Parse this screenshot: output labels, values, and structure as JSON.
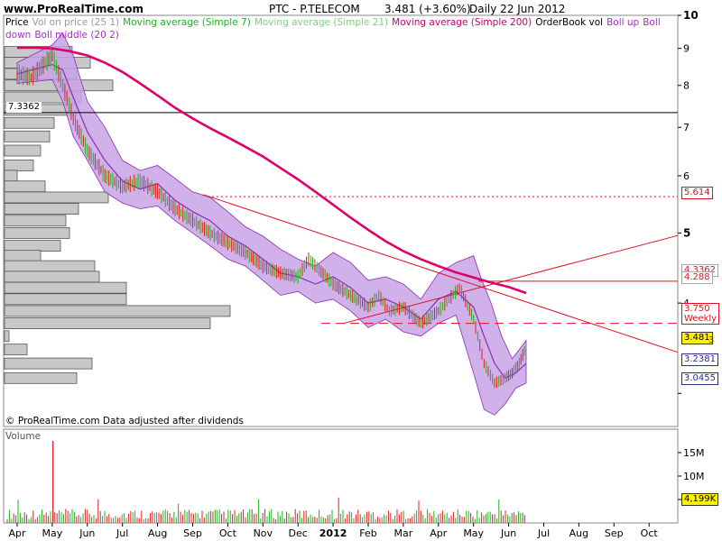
{
  "header": {
    "site": "www.ProRealTime.com",
    "symbol": "PTC - P.TELECOM",
    "price_info": "3.481 (+3.60%)",
    "period_date": "Daily  22 Jun 2012"
  },
  "legend": {
    "items": [
      {
        "text": "Price",
        "color": "#000000"
      },
      {
        "text": "Vol on price (25 1)",
        "color": "#999999"
      },
      {
        "text": "Moving average (Simple 7)",
        "color": "#20b020"
      },
      {
        "text": "Moving average (Simple 21)",
        "color": "#80d080"
      },
      {
        "text": "Moving average (Simple 200)",
        "color": "#c00070"
      },
      {
        "text": "OrderBook vol",
        "color": "#000000"
      },
      {
        "text": "Boll up",
        "color": "#a030c0"
      },
      {
        "text": "Boll down",
        "color": "#a030c0"
      },
      {
        "text": "Boll middle (20 2)",
        "color": "#a030c0"
      }
    ]
  },
  "footer_note": "© ProRealTime.com  Data adjusted after dividends",
  "volume_panel": {
    "title": "Volume",
    "ticks": [
      "15M",
      "10M",
      "5M"
    ],
    "current": "4,199K"
  },
  "price_labels": {
    "hline": "7.3362",
    "level_5614": "5.614",
    "level_4288": "4.288",
    "level_4288_hidden": "4.3362",
    "level_3750": "3.750",
    "weekly": "Weekly",
    "current_price": "3.481",
    "partial_label": "3",
    "ma_low": "3.2381",
    "boll_low": "3.0455"
  },
  "colors": {
    "ma200": "#e0006a",
    "boll_fill": "#c9a3e6",
    "boll_line": "#8a2eb0",
    "trend": "#e01020",
    "hist_fill": "#c8c8c8",
    "hist_stroke": "#555555",
    "up_bar": "#20b020",
    "down_bar": "#e02020"
  },
  "chart_data": {
    "type": "line",
    "title": "PTC - P.TELECOM",
    "yscale": "log",
    "ylim": [
      2.7,
      10
    ],
    "y_ticks": [
      3,
      4,
      5,
      6,
      7,
      8,
      9,
      10
    ],
    "y_tick_labels": [
      "",
      "4",
      "5",
      "6",
      "7",
      "8",
      "9",
      "10"
    ],
    "x_labels": [
      "Apr",
      "May",
      "Jun",
      "Jul",
      "Aug",
      "Sep",
      "Oct",
      "Nov",
      "Dec",
      "2012",
      "Feb",
      "Mar",
      "Apr",
      "May",
      "Jun",
      "Jul",
      "Aug",
      "Sep",
      "Oct"
    ],
    "series": [
      {
        "name": "Price",
        "x": [
          0,
          0.4,
          0.8,
          1,
          1.3,
          1.6,
          2,
          2.5,
          3,
          3.5,
          4,
          4.5,
          5,
          5.5,
          6,
          6.5,
          7,
          7.5,
          8,
          8.3,
          8.6,
          9,
          9.5,
          10,
          10.3,
          10.6,
          11,
          11.5,
          12,
          12.3,
          12.6,
          13,
          13.3,
          13.6,
          13.9,
          14.1,
          14.3,
          14.5
        ],
        "values": [
          8.3,
          8.2,
          8.6,
          8.8,
          8.0,
          7.2,
          6.5,
          6.0,
          5.8,
          5.9,
          5.7,
          5.4,
          5.2,
          5.0,
          4.85,
          4.7,
          4.5,
          4.4,
          4.35,
          4.6,
          4.45,
          4.25,
          4.1,
          3.95,
          4.1,
          3.9,
          3.95,
          3.75,
          3.9,
          4.05,
          4.2,
          3.8,
          3.3,
          3.1,
          3.15,
          3.2,
          3.3,
          3.48
        ]
      },
      {
        "name": "Moving average (Simple 200)",
        "x": [
          0,
          0.5,
          1,
          1.5,
          2,
          2.5,
          3,
          3.5,
          4,
          4.5,
          5,
          5.5,
          6,
          6.5,
          7,
          7.5,
          8,
          8.5,
          9,
          9.5,
          10,
          10.5,
          11,
          11.5,
          12,
          12.5,
          13,
          13.5,
          14,
          14.5
        ],
        "values": [
          9.02,
          9.02,
          9.0,
          8.92,
          8.8,
          8.6,
          8.35,
          8.05,
          7.75,
          7.45,
          7.2,
          6.98,
          6.78,
          6.58,
          6.38,
          6.15,
          5.93,
          5.7,
          5.47,
          5.25,
          5.05,
          4.87,
          4.72,
          4.6,
          4.5,
          4.41,
          4.34,
          4.27,
          4.21,
          4.13
        ]
      },
      {
        "name": "Boll up",
        "x": [
          0,
          1,
          1.3,
          1.6,
          2,
          2.5,
          3,
          3.5,
          4,
          4.5,
          5,
          5.5,
          6,
          6.5,
          7,
          7.5,
          8,
          8.5,
          9,
          9.5,
          10,
          10.5,
          11,
          11.5,
          12,
          12.5,
          13,
          13.2,
          13.5,
          13.8,
          14.1,
          14.5
        ],
        "values": [
          8.6,
          9.1,
          9.45,
          8.8,
          7.6,
          7.0,
          6.3,
          6.1,
          6.2,
          5.95,
          5.7,
          5.6,
          5.35,
          5.1,
          4.95,
          4.75,
          4.6,
          4.5,
          4.7,
          4.55,
          4.3,
          4.35,
          4.25,
          4.05,
          4.4,
          4.55,
          4.65,
          4.35,
          4.0,
          3.6,
          3.35,
          3.55
        ]
      },
      {
        "name": "Boll down",
        "x": [
          0,
          1,
          1.3,
          1.6,
          2,
          2.5,
          3,
          3.5,
          4,
          4.5,
          5,
          5.5,
          6,
          6.5,
          7,
          7.5,
          8,
          8.5,
          9,
          9.5,
          10,
          10.5,
          11,
          11.5,
          12,
          12.5,
          13,
          13.3,
          13.6,
          13.9,
          14.2,
          14.5
        ],
        "values": [
          8.05,
          8.15,
          7.6,
          6.8,
          6.3,
          5.7,
          5.5,
          5.4,
          5.45,
          5.2,
          5.0,
          4.8,
          4.6,
          4.5,
          4.3,
          4.1,
          4.15,
          4.0,
          4.05,
          3.9,
          3.7,
          3.8,
          3.65,
          3.6,
          3.75,
          3.85,
          3.2,
          2.85,
          2.8,
          2.9,
          3.05,
          3.1
        ]
      },
      {
        "name": "Boll middle (20 2)",
        "x": [
          0,
          1,
          1.3,
          1.6,
          2,
          2.5,
          3,
          3.5,
          4,
          4.5,
          5,
          5.5,
          6,
          6.5,
          7,
          7.5,
          8,
          8.5,
          9,
          9.5,
          10,
          10.5,
          11,
          11.5,
          12,
          12.5,
          13,
          13.3,
          13.6,
          13.9,
          14.2,
          14.5
        ],
        "values": [
          8.3,
          8.55,
          8.4,
          7.7,
          6.9,
          6.3,
          5.9,
          5.75,
          5.85,
          5.55,
          5.35,
          5.2,
          4.95,
          4.8,
          4.6,
          4.4,
          4.35,
          4.25,
          4.35,
          4.2,
          4.0,
          4.05,
          3.95,
          3.8,
          4.05,
          4.15,
          3.95,
          3.6,
          3.3,
          3.15,
          3.2,
          3.3
        ]
      }
    ],
    "levels": [
      7.3362,
      5.614,
      4.288,
      3.75
    ],
    "volume_ylim": [
      0,
      20
    ],
    "volume_unit": "M",
    "volume_peak": 17.5,
    "volume_histogram_levels": [
      8.9,
      8.6,
      8.3,
      8.0,
      7.7,
      7.4,
      7.1,
      6.8,
      6.5,
      6.2,
      6.0,
      5.8,
      5.6,
      5.4,
      5.2,
      5.0,
      4.8,
      4.65,
      4.5,
      4.35,
      4.2,
      4.05,
      3.9,
      3.75,
      3.6,
      3.45,
      3.3,
      3.15
    ],
    "volume_histogram_values": [
      75,
      95,
      80,
      120,
      85,
      80,
      55,
      50,
      40,
      32,
      14,
      45,
      115,
      82,
      68,
      72,
      62,
      40,
      100,
      105,
      135,
      135,
      250,
      228,
      5,
      25,
      97,
      80
    ]
  }
}
